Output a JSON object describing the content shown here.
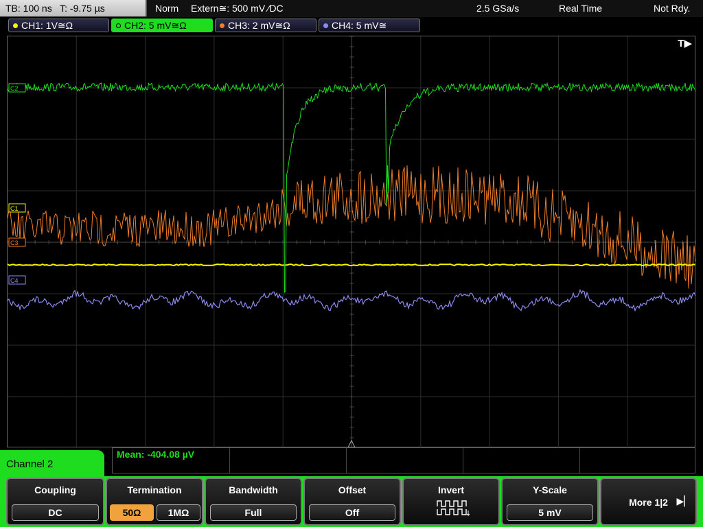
{
  "status": {
    "timebase": "TB: 100 ns",
    "trigger_time": "T: -9.75 µs",
    "mode": "Norm",
    "trigger_source": "Extern≅: 500 mV ∕DC",
    "sample_rate": "2.5 GSa/s",
    "acq_mode": "Real Time",
    "state": "Not Rdy."
  },
  "channels": [
    {
      "label": "CH1: 1V≅Ω",
      "color": "#f6f600",
      "active": false
    },
    {
      "label": "CH2: 5 mV≅Ω",
      "color": "#1edc1e",
      "active": true
    },
    {
      "label": "CH3: 2 mV≅Ω",
      "color": "#f07d28",
      "active": false
    },
    {
      "label": "CH4: 5 mV≅",
      "color": "#8c8cf0",
      "active": false
    }
  ],
  "markers": {
    "c1": "C1",
    "c2": "C2",
    "c3": "C3",
    "c4": "C4",
    "trigger_indicator": "T▶"
  },
  "measurement": {
    "mean": "Mean: -404.08 µV"
  },
  "menu": {
    "channel_title": "Channel 2",
    "coupling": {
      "title": "Coupling",
      "value": "DC"
    },
    "termination": {
      "title": "Termination",
      "opt1": "50Ω",
      "opt2": "1MΩ",
      "selected": "50Ω"
    },
    "bandwidth": {
      "title": "Bandwidth",
      "value": "Full"
    },
    "offset": {
      "title": "Offset",
      "value": "Off"
    },
    "invert": {
      "title": "Invert",
      "icon": "invert-square-wave-icon"
    },
    "yscale": {
      "title": "Y-Scale",
      "value": "5 mV"
    },
    "more": {
      "label": "More 1|2"
    }
  },
  "colors": {
    "accent": "#1edc1e",
    "ch1": "#f6f600",
    "ch2": "#1edc1e",
    "ch3": "#f07d28",
    "ch4": "#8c8cf0",
    "selected": "#f0a23c"
  }
}
